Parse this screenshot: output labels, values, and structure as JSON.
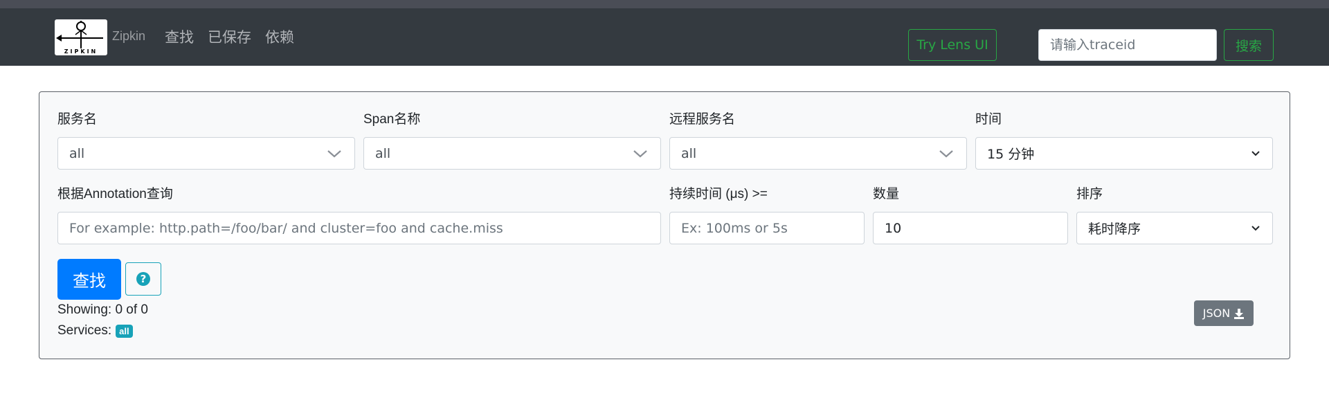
{
  "nav": {
    "brand": "Zipkin",
    "logo_text": "ZIPKIN",
    "links": [
      "查找",
      "已保存",
      "依赖"
    ],
    "lens_button": "Try Lens UI",
    "traceid_placeholder": "请输入traceid",
    "search_button": "搜索"
  },
  "form": {
    "service_label": "服务名",
    "service_value": "all",
    "span_label": "Span名称",
    "span_value": "all",
    "remote_label": "远程服务名",
    "remote_value": "all",
    "time_label": "时间",
    "time_value": "15 分钟",
    "annotation_label": "根据Annotation查询",
    "annotation_placeholder": "For example: http.path=/foo/bar/ and cluster=foo and cache.miss",
    "duration_label": "持续时间 (μs) >=",
    "duration_placeholder": "Ex: 100ms or 5s",
    "limit_label": "数量",
    "limit_value": "10",
    "sort_label": "排序",
    "sort_value": "耗时降序",
    "find_button": "查找",
    "help_icon": "?"
  },
  "results": {
    "showing": "Showing: 0 of 0",
    "services_label": "Services:",
    "services_badge": "all",
    "json_button": "JSON"
  },
  "colors": {
    "navbar": "#343a40",
    "success": "#28a745",
    "primary": "#007bff",
    "info": "#17a2b8",
    "secondary": "#6c757d"
  },
  "icons": {
    "dropdown": "chevron-down-icon",
    "help": "question-circle-icon",
    "download": "download-icon"
  }
}
